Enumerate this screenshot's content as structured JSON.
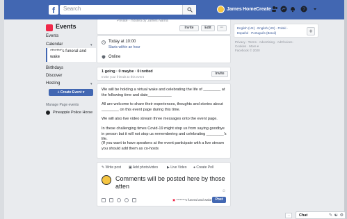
{
  "topbar": {
    "logo": "f",
    "search_placeholder": "Search",
    "user_name": "James",
    "home_label": "Home",
    "create_label": "Create"
  },
  "sidebar": {
    "title": "Events",
    "items": [
      "Events",
      "Calendar",
      "Birthdays",
      "Discover",
      "Hosting"
    ],
    "selected_line1": "*******'s funeral and",
    "selected_line2": "wake",
    "create_button": "+ Create Event ▾",
    "manage_label": "Manage Page events",
    "page_name": "Pineapple Police Horse"
  },
  "event_header": {
    "hosted_text": "Private · Hosted by James Nahra",
    "invite_label": "Invite",
    "edit_label": "Edit",
    "more_label": "···"
  },
  "event_details": {
    "time": "Today at 10:00",
    "time_sub": "Starts within an hour",
    "location": "Online"
  },
  "guests": {
    "summary": "1 going · 0 maybe · 0 invited",
    "sub": "Invite your friends to this event",
    "invite_label": "Invite"
  },
  "description": [
    "We will be holding a virtual wake and celebrating the life of ________ at the following time and date___________",
    "All are welcome to share their experiences, thoughts and stories about ________ on this event page during this time.",
    "We will also live video stream three messages onto the event page.",
    "In these challenging times Covid-19 might stop us from saying goodbye in person but it will not stop us remembering and celebrating ________'s life.",
    "(If you want to have speakers at the event participate with a live stream you should add them as co-hosts"
  ],
  "composer": {
    "tab_write": "Write post",
    "tab_photo": "Add photo/video",
    "tab_live": "Live Video",
    "tab_poll": "Create Poll",
    "text_line1": "Comments will be posted here by those",
    "text_line2": "atten",
    "audience": "*******'s funeral and wake",
    "post_label": "Post"
  },
  "right_column": {
    "lang_line1": "English (UK) · English (US) · Polski ·",
    "lang_line2": "Español · Português (Brasil)",
    "plus": "+",
    "footer_line1": "Privacy · Terms · Advertising · AdChoices ·",
    "footer_line2": "Cookies · More ▾",
    "footer_line3": "Facebook © 2020"
  },
  "chat": {
    "label": "Chat"
  },
  "colors": {
    "brand": "#4267b2",
    "background": "#e9ebee",
    "event_icon": "#f02849"
  }
}
